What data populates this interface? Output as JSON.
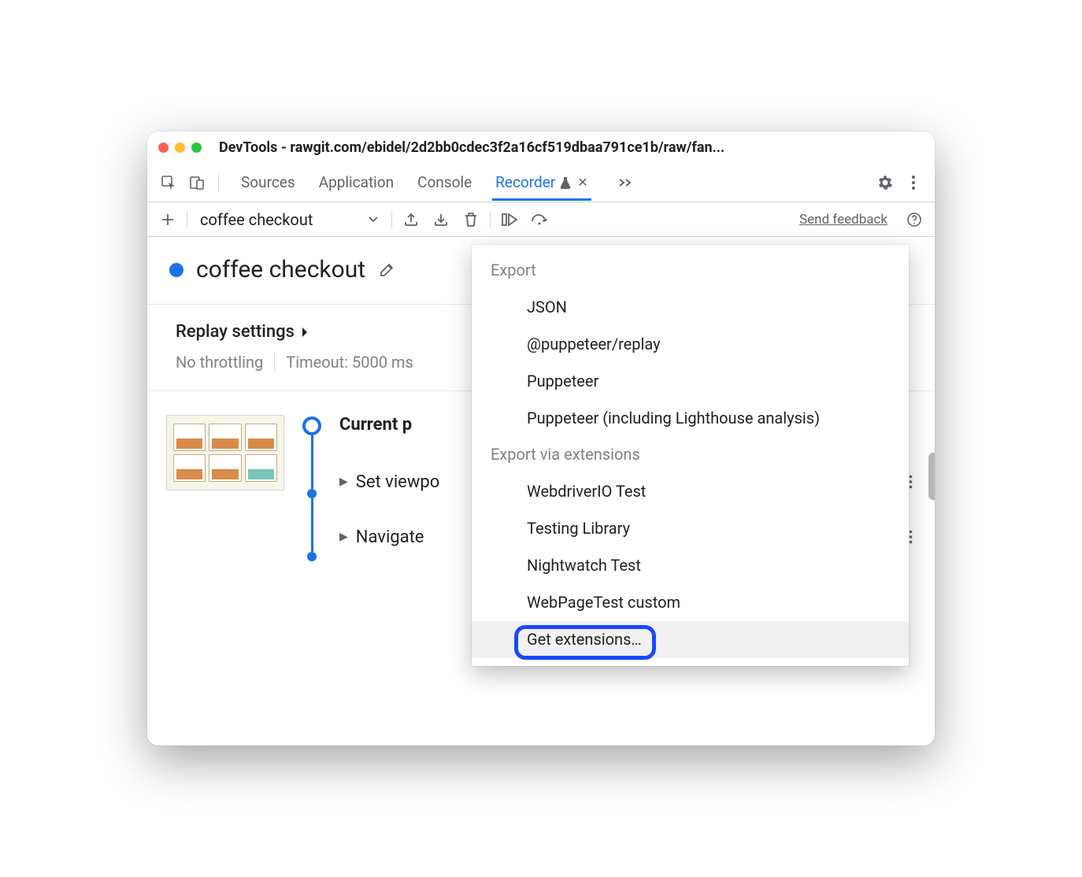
{
  "window": {
    "title": "DevTools - rawgit.com/ebidel/2d2bb0cdec3f2a16cf519dbaa791ce1b/raw/fan..."
  },
  "tabs": {
    "items": [
      "Sources",
      "Application",
      "Console",
      "Recorder"
    ],
    "activeIndex": 3
  },
  "toolbar": {
    "recording_name": "coffee checkout",
    "feedback_label": "Send feedback"
  },
  "recording": {
    "title": "coffee checkout"
  },
  "replay": {
    "header": "Replay settings",
    "throttling": "No throttling",
    "timeout": "Timeout: 5000 ms"
  },
  "steps": {
    "current_label": "Current p",
    "items": [
      "Set viewpo",
      "Navigate"
    ]
  },
  "dropdown": {
    "section1_header": "Export",
    "section1_items": [
      "JSON",
      "@puppeteer/replay",
      "Puppeteer",
      "Puppeteer (including Lighthouse analysis)"
    ],
    "section2_header": "Export via extensions",
    "section2_items": [
      "WebdriverIO Test",
      "Testing Library",
      "Nightwatch Test",
      "WebPageTest custom",
      "Get extensions…"
    ]
  }
}
